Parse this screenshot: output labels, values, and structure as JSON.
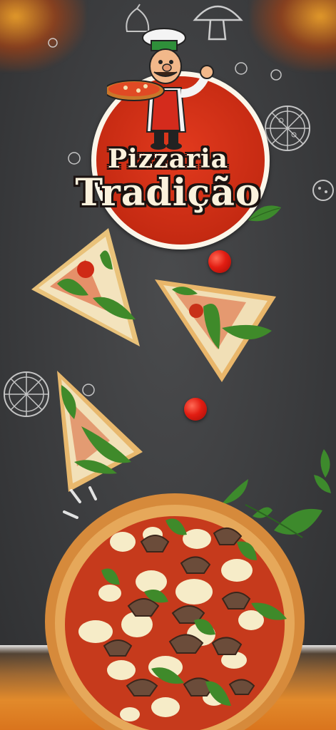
{
  "brand": {
    "line1": "Pizzaria",
    "line2": "Tradição"
  },
  "colors": {
    "background": "#3b3c3e",
    "logo_red": "#c52a12",
    "logo_cream": "#fbf6ea",
    "text_outline": "#1b1210",
    "bottom_flame": "#d9741d"
  },
  "icons": [
    "chef-mascot-icon",
    "pizza-doodle-icon",
    "mushroom-doodle-icon",
    "tomato-icon",
    "basil-leaf-icon"
  ]
}
